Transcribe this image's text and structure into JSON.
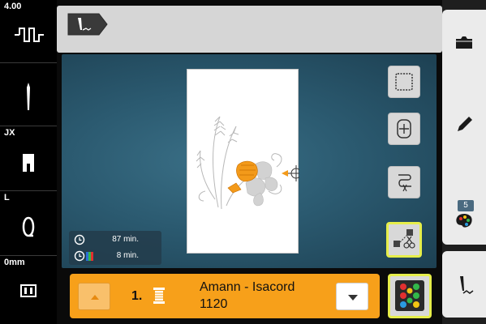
{
  "left_sidebar": {
    "stitch_value": "4.00",
    "needle_value": "",
    "presser_foot": "JX",
    "hoop_size": "L",
    "offset_value": "0mm"
  },
  "time_info": {
    "total_time": "87 min.",
    "color_time": "8 min."
  },
  "thread": {
    "index": "1.",
    "name": "Amann - Isacord",
    "code": "1120"
  },
  "right_sidebar": {
    "color_count_badge": "5"
  },
  "icons": {
    "top_back": "embroidery-back-icon",
    "hoop_view": "hoop-outline-icon",
    "move_design": "move-design-icon",
    "stitch_path": "stitch-path-icon",
    "cut_thread": "thread-cut-icon",
    "color_palette": "color-dots-icon",
    "folder": "folder-icon",
    "pencil": "edit-pencil-icon",
    "palette": "palette-icon",
    "embroidery_mode": "embroidery-needle-icon"
  },
  "colors": {
    "accent_orange": "#f7a01a",
    "selected_outline": "#e6ee4a",
    "background_teal": "#2b5a70"
  }
}
